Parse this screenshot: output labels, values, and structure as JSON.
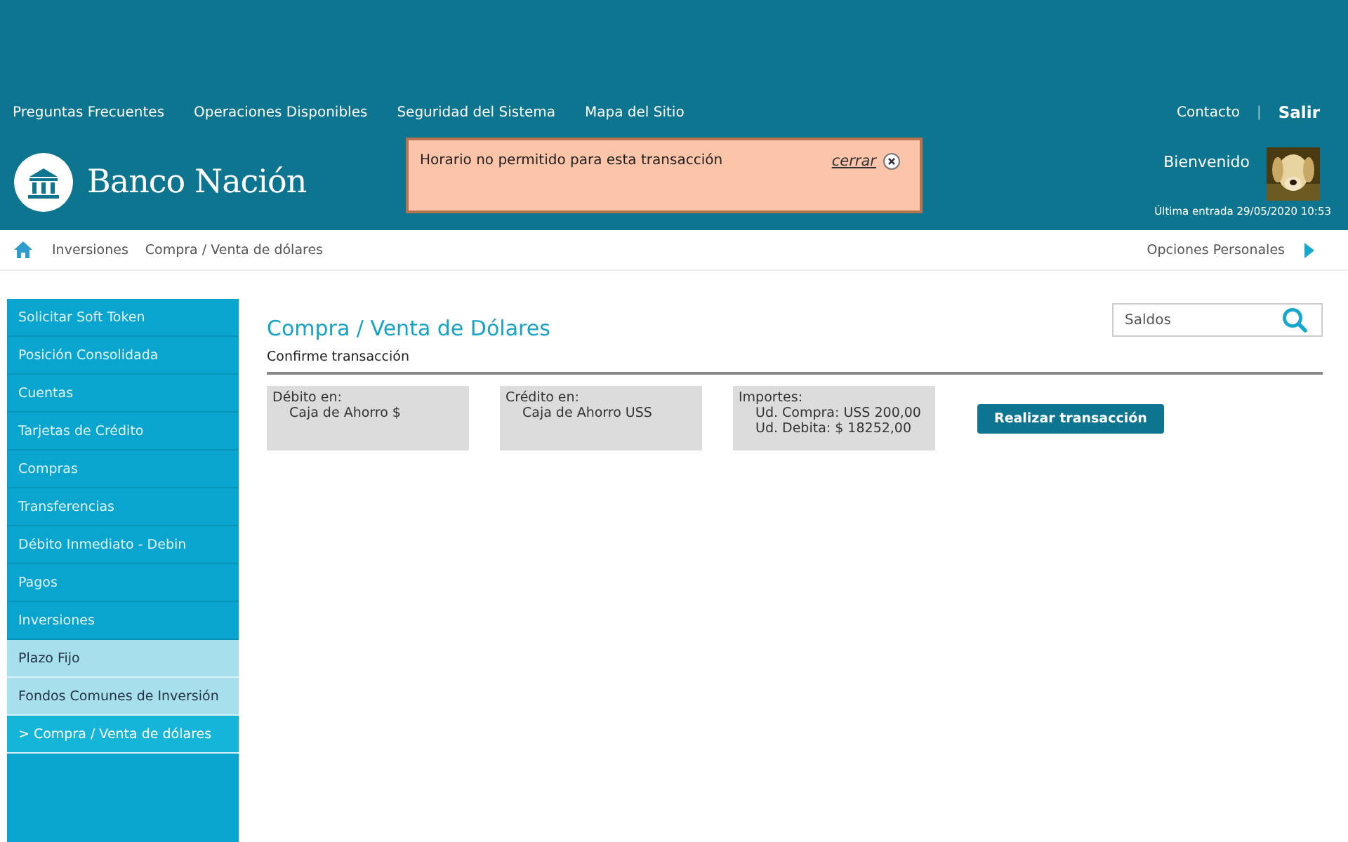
{
  "top_links": [
    "Preguntas Frecuentes",
    "Operaciones Disponibles",
    "Seguridad del Sistema",
    "Mapa del Sitio"
  ],
  "user_links": {
    "contact": "Contacto",
    "separator": "|",
    "logout": "Salir"
  },
  "logo": {
    "text": "Banco Nación"
  },
  "alert": {
    "message": "Horario no permitido para esta transacción",
    "close_label": "cerrar"
  },
  "user": {
    "greeting": "Bienvenido",
    "last_login": "Última entrada 29/05/2020 10:53"
  },
  "breadcrumb": [
    "Inversiones",
    "Compra / Venta de dólares"
  ],
  "personal_options": "Opciones Personales",
  "sidebar": {
    "items": [
      {
        "label": "Solicitar Soft Token",
        "kind": "main",
        "selected": false
      },
      {
        "label": "Posición Consolidada",
        "kind": "main",
        "selected": false
      },
      {
        "label": "Cuentas",
        "kind": "main",
        "selected": false
      },
      {
        "label": "Tarjetas de Crédito",
        "kind": "main",
        "selected": false
      },
      {
        "label": "Compras",
        "kind": "main",
        "selected": false
      },
      {
        "label": "Transferencias",
        "kind": "main",
        "selected": false
      },
      {
        "label": "Débito Inmediato - Debin",
        "kind": "main",
        "selected": false
      },
      {
        "label": "Pagos",
        "kind": "main",
        "selected": false
      },
      {
        "label": "Inversiones",
        "kind": "main",
        "selected": false
      },
      {
        "label": "Plazo Fijo",
        "kind": "sub",
        "selected": false
      },
      {
        "label": "Fondos Comunes de Inversión",
        "kind": "sub",
        "selected": false
      },
      {
        "label": ">  Compra / Venta de dólares",
        "kind": "sub",
        "selected": true
      }
    ]
  },
  "page_title": "Compra / Venta de Dólares",
  "search": {
    "placeholder": "Saldos"
  },
  "subtitle": "Confirme transacción",
  "cards": [
    {
      "heading": "Débito en:",
      "lines": [
        "Caja de Ahorro $"
      ]
    },
    {
      "heading": "Crédito en:",
      "lines": [
        "Caja de Ahorro USS"
      ]
    },
    {
      "heading": "Importes:",
      "lines": [
        "Ud. Compra: USS 200,00",
        "Ud. Debita: $ 18252,00"
      ]
    }
  ],
  "submit_button": "Realizar transacción"
}
